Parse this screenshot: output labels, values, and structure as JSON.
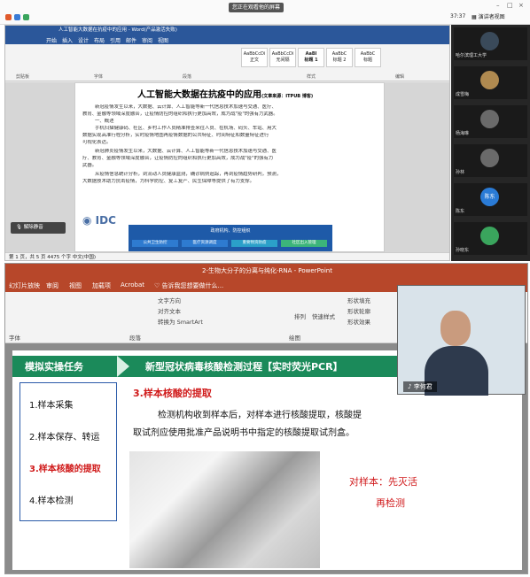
{
  "meeting": {
    "share_badge": "您正在观看他的屏幕",
    "time": "37:37",
    "view_label": "演讲者视图",
    "win_minimize": "–",
    "win_maximize": "□",
    "win_close": "×"
  },
  "word": {
    "title": "人工智能大数据在抗疫中的应用 - Word(产品激活失败)",
    "tabs": [
      "开始",
      "插入",
      "设计",
      "布局",
      "引用",
      "邮件",
      "审阅",
      "视图"
    ],
    "styles": [
      "AaBbCcDi",
      "AaBbCcDi",
      "AaBl",
      "AaBbC",
      "AaBbC"
    ],
    "style_names": [
      "正文",
      "无间隔",
      "标题 1",
      "标题 2",
      "标题"
    ],
    "ribbon_groups": [
      "剪贴板",
      "字体",
      "段落",
      "样式",
      "编辑"
    ],
    "doc_title": "人工智能大数据在抗疫中的应用",
    "doc_title_note": "(文章来源：ITPUB 博客)",
    "doc_lines": [
      "新冠疫情发生以来，大数据、云计算、人工智能等新一代信息技术加速与交通、医疗、",
      "教育、金融等领域深度融合，让疫情防控的组织和执行更加高效，成为战\"疫\"的强有力武器。",
      "一、概述",
      "手机扫描健康码、社区、乡村工作人员精准排查来往人员、在机场、码头、车站、用大",
      "数据实现高准行程分析，实时疫情地图再疫情数据的公共特征、时间特征和数量特征进行",
      "可视化表达。",
      "新冠肺炎疫情发生以来，大数据、云计算、人工智能等新一代信息技术加速与交通、医",
      "疗、教育、金融等领域深度融合，让疫情防控的组织和执行更加高效，成为战\"疫\"的强有力",
      "武器。",
      "从疫情信息统计分析，到流动人员健康监测，确诊病例追踪，再到疫情趋势研判，预测，",
      "大数据技术助力抗击疫情，为科学防控、复工复产、民生保障等提供了有力支撑。"
    ],
    "idc": "IDC",
    "idc_header": "政府机构、防控组织",
    "idc_cells": [
      "公共卫生防控",
      "医疗资源调度",
      "重要物资防疫",
      "社区出入管理"
    ],
    "status": "第 1 页，共 5 页    4475 个字    中文(中国)",
    "audio_popup": "解除静音"
  },
  "participants": [
    {
      "name": "哈尔滨理工大学"
    },
    {
      "name": "成雪梅"
    },
    {
      "name": "杨海琳"
    },
    {
      "name": "孙林"
    },
    {
      "name": "陈东"
    },
    {
      "name": "孙晓东"
    }
  ],
  "ppt": {
    "title": "2-生物大分子的分离与纯化-RNA - PowerPoint",
    "tabs": [
      "幻灯片放映",
      "审阅",
      "视图",
      "加载项",
      "Acrobat"
    ],
    "tell_me": "告诉我您想要做什么...",
    "groups": [
      "字体",
      "段落",
      "绘图"
    ],
    "ribbon_texts": [
      "文字方向",
      "对齐文本",
      "转换为 SmartArt",
      "排列",
      "快速样式",
      "形状填充",
      "形状轮廓",
      "形状效果"
    ],
    "banner_left": "模拟实操任务",
    "banner_right": "新型冠状病毒核酸检测过程【实时荧光PCR】",
    "steps": [
      "1.样本采集",
      "2.样本保存、转运",
      "3.样本核酸的提取",
      "4.样本检测"
    ],
    "section_title": "3.样本核酸的提取",
    "body": [
      "检测机构收到样本后，对样本进行核酸提取，核酸提",
      "取试剂应使用批准产品说明书中指定的核酸提取试剂盒。"
    ],
    "note_line1": "对样本：先灭活",
    "note_line2": "再检测",
    "camera_name": "李何君"
  },
  "colors": {
    "word_blue": "#2b579a",
    "ppt_red": "#b7472a",
    "banner_green": "#1b8a5a",
    "highlight_red": "#d01a1a"
  }
}
